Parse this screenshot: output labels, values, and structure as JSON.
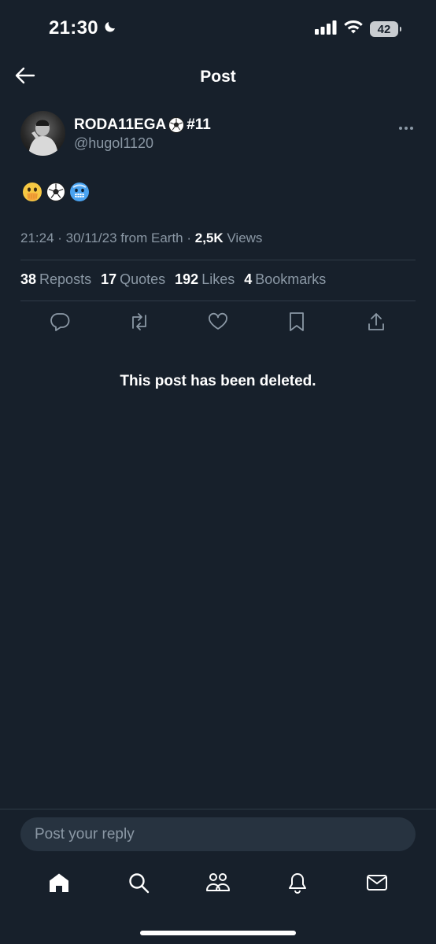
{
  "status_bar": {
    "time": "21:30",
    "battery": "42"
  },
  "header": {
    "title": "Post"
  },
  "author": {
    "name": "RODA11EGA",
    "name_suffix": "#11",
    "handle": "@hugol1120"
  },
  "post": {
    "text": "🫢⚽🥶",
    "timestamp": "21:24 · 30/11/23 from Earth · ",
    "views_count": "2,5K",
    "views_label": " Views"
  },
  "stats": {
    "reposts_count": "38",
    "reposts_label": "Reposts",
    "quotes_count": "17",
    "quotes_label": "Quotes",
    "likes_count": "192",
    "likes_label": "Likes",
    "bookmarks_count": "4",
    "bookmarks_label": "Bookmarks"
  },
  "deleted_notice": "This post has been deleted.",
  "reply": {
    "placeholder": "Post your reply"
  },
  "icons": [
    "moon-icon",
    "cellular-signal-icon",
    "wifi-icon",
    "back-arrow-icon",
    "more-icon",
    "reply-icon",
    "repost-icon",
    "like-icon",
    "bookmark-icon",
    "share-icon",
    "home-icon",
    "search-icon",
    "communities-icon",
    "notifications-icon",
    "messages-icon"
  ],
  "colors": {
    "background": "#17202b",
    "text": "#e7e9ea",
    "secondary": "#8b98a5",
    "divider": "#2f3b47",
    "input_bg": "#273340"
  }
}
